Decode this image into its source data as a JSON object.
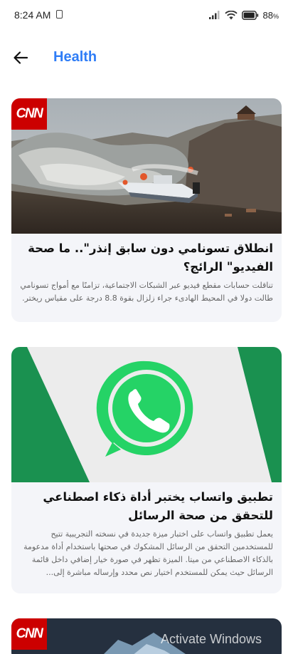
{
  "status_bar": {
    "time": "8:24 AM",
    "battery_percent": "88",
    "battery_suffix": "%",
    "icons": [
      "sim-card-icon",
      "signal-icon",
      "wifi-icon",
      "battery-icon"
    ]
  },
  "app_bar": {
    "title": "Health",
    "back_icon": "arrow-left-icon",
    "title_color": "#2f7df6"
  },
  "articles": [
    {
      "source_logo": "CNN",
      "title": "انطلاق تسونامي دون سابق إنذر\".. ما صحة الفيديو\" الرائج؟",
      "summary": "تناقلت حسابات مقطع فيديو عبر الشبكات الاجتماعية، تزامنًا مع أمواج تسونامي طالت دولا في المحيط الهادىء جراء زلزال بقوة 8.8 درجة على مقياس ريختر."
    },
    {
      "title": "تطبيق واتساب يختبر أداة ذكاء اصطناعي للتحقق من صحة الرسائل",
      "summary": "يعمل تطبيق واتساب على اختبار ميزة جديدة في نسخته التجريبية تتيح للمستخدمين التحقق من الرسائل المشكوك في صحتها باستخدام أداة مدعومة بالذكاء الاصطناعي من ميتا. الميزة تظهر في صورة خيار إضافي داخل قائمة الرسائل حيث يمكن للمستخدم اختيار نص محدد وإرساله مباشرة إلى..."
    },
    {
      "source_logo": "CNN"
    }
  ],
  "overlay": {
    "watermark": "Activate Windows"
  },
  "colors": {
    "card_bg": "#f4f5f9",
    "cnn_red": "#cc0000",
    "whatsapp_green": "#25d366",
    "whatsapp_band": "#1a9150"
  }
}
